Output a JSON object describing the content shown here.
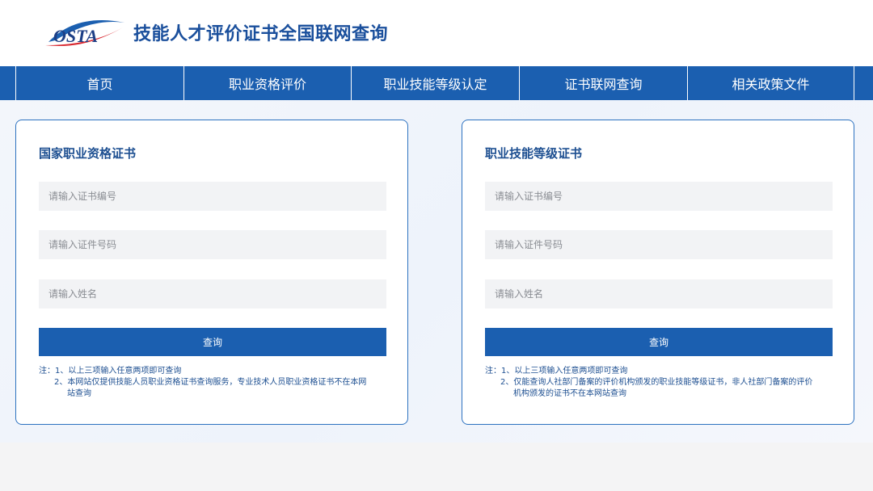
{
  "header": {
    "logo_text": "OSTA",
    "title": "技能人才评价证书全国联网查询"
  },
  "nav": {
    "items": [
      {
        "label": "首页"
      },
      {
        "label": "职业资格评价"
      },
      {
        "label": "职业技能等级认定"
      },
      {
        "label": "证书联网查询"
      },
      {
        "label": "相关政策文件"
      }
    ]
  },
  "cards": [
    {
      "title": "国家职业资格证书",
      "fields": {
        "cert_no_placeholder": "请输入证书编号",
        "id_no_placeholder": "请输入证件号码",
        "name_placeholder": "请输入姓名"
      },
      "button_label": "查询",
      "notes": [
        "注：1、以上三项输入任意两项即可查询",
        "2、本网站仅提供技能人员职业资格证书查询服务，专业技术人员职业资格证书不在本网",
        "站查询"
      ]
    },
    {
      "title": "职业技能等级证书",
      "fields": {
        "cert_no_placeholder": "请输入证书编号",
        "id_no_placeholder": "请输入证件号码",
        "name_placeholder": "请输入姓名"
      },
      "button_label": "查询",
      "notes": [
        "注：1、以上三项输入任意两项即可查询",
        "2、仅能查询人社部门备案的评价机构颁发的职业技能等级证书，非人社部门备案的评价",
        "机构颁发的证书不在本网站查询"
      ]
    }
  ],
  "colors": {
    "brand_blue": "#1b5fb0",
    "title_blue": "#1d4f91"
  }
}
